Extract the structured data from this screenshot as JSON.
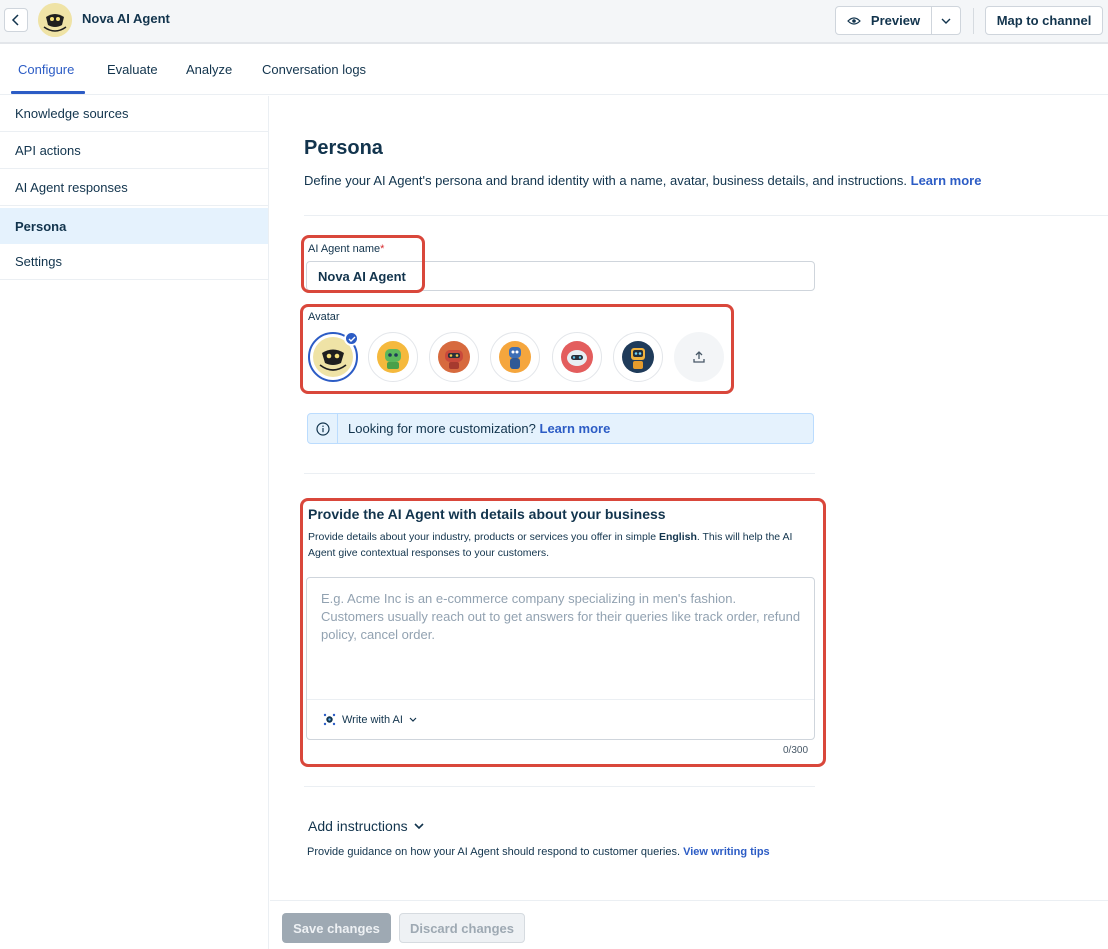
{
  "header": {
    "title": "Nova AI Agent",
    "preview_label": "Preview",
    "map_label": "Map to channel"
  },
  "tabs": [
    {
      "label": "Configure",
      "active": true
    },
    {
      "label": "Evaluate",
      "active": false
    },
    {
      "label": "Analyze",
      "active": false
    },
    {
      "label": "Conversation logs",
      "active": false
    }
  ],
  "sidebar": {
    "items": [
      {
        "label": "Knowledge sources",
        "active": false
      },
      {
        "label": "API actions",
        "active": false
      },
      {
        "label": "AI Agent responses",
        "active": false
      },
      {
        "label": "Persona",
        "active": true
      },
      {
        "label": "Settings",
        "active": false
      }
    ]
  },
  "persona": {
    "title": "Persona",
    "description": "Define your AI Agent's persona and brand identity with a name, avatar, business details, and instructions.",
    "learn_more": "Learn more",
    "name_label": "AI Agent name",
    "required_mark": "*",
    "name_value": "Nova AI Agent",
    "avatar_label": "Avatar",
    "avatars": [
      {
        "name": "nova-avatar",
        "selected": true,
        "color": "#efe3a6"
      },
      {
        "name": "green-robot-avatar",
        "selected": false,
        "color": "#5cb85c"
      },
      {
        "name": "red-robot-avatar",
        "selected": false,
        "color": "#c9493b"
      },
      {
        "name": "blue-robot-avatar",
        "selected": false,
        "color": "#3d6fb6"
      },
      {
        "name": "white-robot-avatar",
        "selected": false,
        "color": "#e35d5d"
      },
      {
        "name": "dark-robot-avatar",
        "selected": false,
        "color": "#1f3b5a"
      }
    ],
    "info_text": "Looking for more customization?",
    "info_link": "Learn more"
  },
  "business": {
    "title": "Provide the AI Agent with details about your business",
    "desc_before": "Provide details about your industry, products or services you offer in simple ",
    "desc_bold": "English",
    "desc_after": ". This will help the AI Agent give contextual responses to your customers.",
    "placeholder": "E.g. Acme Inc is an e-commerce company specializing in men's fashion. Customers usually reach out to get answers for their queries like track order, refund policy, cancel order.",
    "write_ai_label": "Write with AI",
    "counter": "0/300"
  },
  "instructions": {
    "title": "Add instructions",
    "desc": "Provide guidance on how your AI Agent should respond to customer queries.",
    "link": "View writing tips"
  },
  "footer": {
    "save_label": "Save changes",
    "discard_label": "Discard changes"
  },
  "colors": {
    "accent": "#2c5cc5",
    "highlight": "#d9473b",
    "active_bg": "#e5f2fd"
  }
}
